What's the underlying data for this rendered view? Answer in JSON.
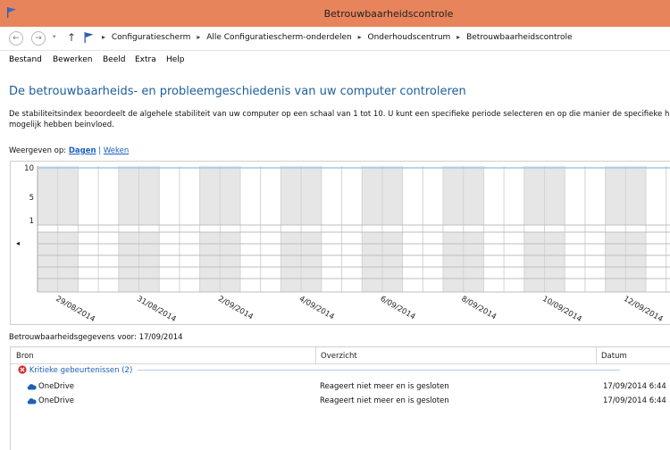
{
  "window": {
    "title": "Betrouwbaarheidscontrole"
  },
  "address": {
    "breadcrumbs": [
      "Configuratiescherm",
      "Alle Configuratiescherm-onderdelen",
      "Onderhoudscentrum",
      "Betrouwbaarheidscontrole"
    ]
  },
  "menu": {
    "items": [
      "Bestand",
      "Bewerken",
      "Beeld",
      "Extra",
      "Help"
    ]
  },
  "page": {
    "heading": "De betrouwbaarheids- en probleemgeschiedenis van uw computer controleren",
    "description": "De stabiliteitsindex beoordeelt de algehele stabiliteit van uw computer op een schaal van 1 tot 10. U kunt een specifieke periode selecteren en op die manier de specifieke h mogelijk hebben beinvloed.",
    "view_label": "Weergeven op:",
    "view_days": "Dagen",
    "view_separator": "|",
    "view_weeks": "Weken"
  },
  "chart_data": {
    "type": "line",
    "ylim": [
      1,
      10
    ],
    "yticks": [
      "10",
      "5",
      "1"
    ],
    "x": [
      "29/08/2014",
      "31/08/2014",
      "2/09/2014",
      "4/09/2014",
      "6/09/2014",
      "8/09/2014",
      "10/09/2014",
      "12/09/2014"
    ],
    "values": [
      10,
      10,
      10,
      10,
      10,
      10,
      10,
      10
    ],
    "grid": true,
    "accent": "#9fc6e8"
  },
  "details": {
    "label": "Betrouwbaarheidsgegevens voor: 17/09/2014",
    "columns": [
      "Bron",
      "Overzicht",
      "Datum"
    ],
    "group": "Kritieke gebeurtenissen (2)",
    "rows": [
      {
        "source": "OneDrive",
        "summary": "Reageert niet meer en is gesloten",
        "date": "17/09/2014 6:44"
      },
      {
        "source": "OneDrive",
        "summary": "Reageert niet meer en is gesloten",
        "date": "17/09/2014 6:44"
      }
    ]
  },
  "icons": {
    "app": "reliability-flag-icon",
    "back": "back-arrow-icon",
    "forward": "forward-arrow-icon",
    "up": "up-arrow-icon",
    "critical": "critical-error-icon",
    "onedrive": "onedrive-cloud-icon",
    "scroll": "scroll-left-icon"
  }
}
